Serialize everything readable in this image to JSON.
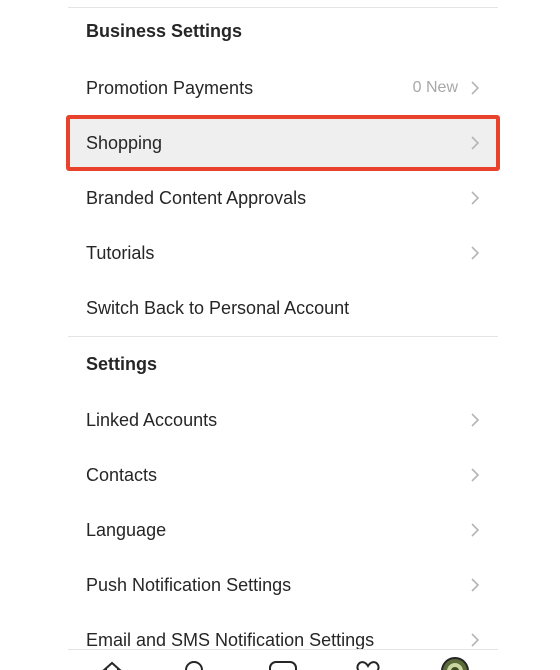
{
  "business_settings": {
    "header": "Business Settings",
    "items": [
      {
        "label": "Promotion Payments",
        "meta": "0 New",
        "chevron": true
      },
      {
        "label": "Shopping",
        "meta": "",
        "chevron": true,
        "highlighted": true
      },
      {
        "label": "Branded Content Approvals",
        "meta": "",
        "chevron": true
      },
      {
        "label": "Tutorials",
        "meta": "",
        "chevron": true
      },
      {
        "label": "Switch Back to Personal Account",
        "meta": "",
        "chevron": false
      }
    ]
  },
  "settings": {
    "header": "Settings",
    "items": [
      {
        "label": "Linked Accounts",
        "chevron": true
      },
      {
        "label": "Contacts",
        "chevron": true
      },
      {
        "label": "Language",
        "chevron": true
      },
      {
        "label": "Push Notification Settings",
        "chevron": true
      },
      {
        "label": "Email and SMS Notification Settings",
        "chevron": true
      }
    ]
  },
  "highlight_color": "#e8412c",
  "tab_bar": {
    "icons": [
      "home-icon",
      "search-icon",
      "add-post-icon",
      "heart-icon",
      "profile-avatar-icon"
    ]
  }
}
